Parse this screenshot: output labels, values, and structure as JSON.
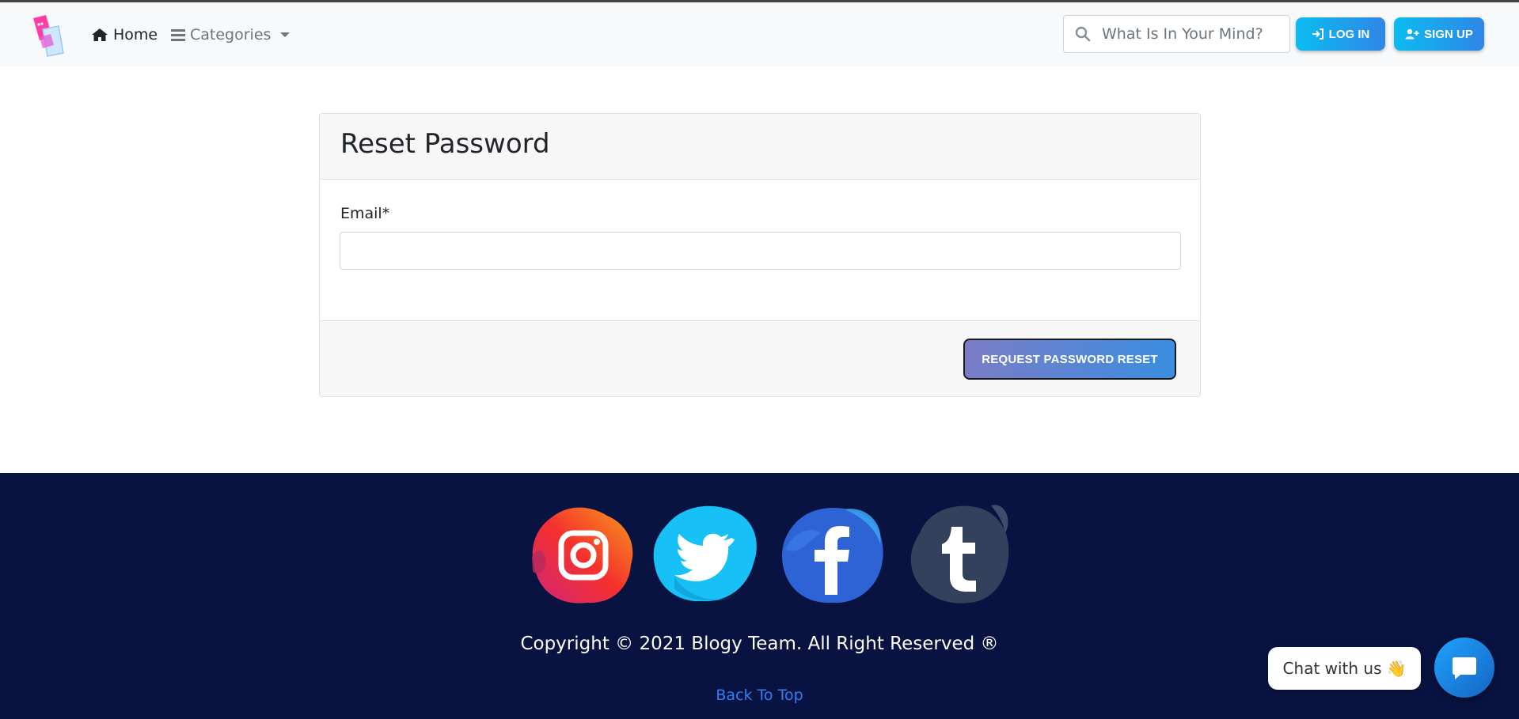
{
  "nav": {
    "home_label": "Home",
    "categories_label": "Categories",
    "search_placeholder": "What Is In Your Mind?",
    "login_label": "LOG IN",
    "signup_label": "SIGN UP"
  },
  "card": {
    "title": "Reset Password",
    "email_label": "Email*",
    "email_value": "",
    "submit_label": "REQUEST PASSWORD RESET"
  },
  "footer": {
    "social": [
      "instagram-icon",
      "twitter-icon",
      "facebook-icon",
      "tumblr-icon"
    ],
    "copyright": "Copyright © 2021 Blogy Team. All Right Reserved ®",
    "back_to_top": "Back To Top"
  },
  "chat": {
    "bubble_text": "Chat with us",
    "wave_emoji": "👋"
  },
  "colors": {
    "navbar_bg": "#f8f9fa",
    "footer_bg": "#081341",
    "accent": "#1ea7f2",
    "link": "#2d7ff9"
  }
}
